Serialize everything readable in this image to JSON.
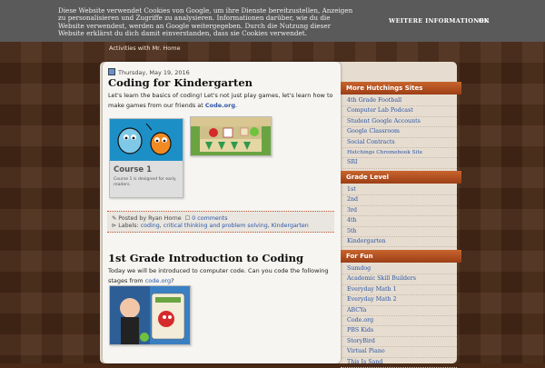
{
  "cookie": {
    "text": "Diese Website verwendet Cookies von Google, um ihre Dienste bereitzustellen, Anzeigen zu personalisieren und Zugriffe zu analysieren. Informationen darüber, wie du die Website verwendest, werden an Google weitergegeben. Durch die Nutzung dieser Website erklärst du dich damit einverstanden, dass sie Cookies verwendet.",
    "more": "WEITERE INFORMATIONEN",
    "ok": "OK"
  },
  "nav": {
    "link": "Activities with Mr. Home"
  },
  "post1": {
    "date": "Thursday, May 19, 2016",
    "title": "Coding for Kindergarten",
    "body_pre": "Let's learn the basics of coding! Let's not just play games, let's learn how to make games from our friends at ",
    "body_link": "Code.org",
    "body_post": ".",
    "card_title": "Course 1",
    "card_desc": "Course 1 is designed for early readers.",
    "posted_by": "Posted by Ryan Horne",
    "comments": "0 comments",
    "labels_label": "Labels:",
    "labels": [
      "coding",
      "critical thinking and problem solving",
      "Kindergarten"
    ]
  },
  "post2": {
    "title": "1st Grade Introduction to Coding",
    "body_pre": "Today we will be introduced to computer code. Can you code the following stages from ",
    "body_link": "code.org",
    "body_post": "?"
  },
  "sidebar": {
    "hutchings": {
      "title": "More Hutchings Sites",
      "items": [
        "4th Grade Football",
        "Computer Lab Podcast",
        "Student Google Accounts",
        "Google Classroom",
        "Social Contracts",
        "Hutchings Chromebook Site",
        "SRI"
      ]
    },
    "grade": {
      "title": "Grade Level",
      "items": [
        "1st",
        "2nd",
        "3rd",
        "4th",
        "5th",
        "Kindergarten"
      ]
    },
    "fun": {
      "title": "For Fun",
      "items": [
        "Sumdog",
        "Academic Skill Builders",
        "Everyday Math 1",
        "Everyday Math 2",
        "ABCYa",
        "Code.org",
        "PBS Kids",
        "StoryBird",
        "Virtual Piano",
        "This Is Sand"
      ]
    }
  },
  "colors": {
    "accent": "#b4522a",
    "link": "#2b55a5",
    "background": "#4a2a17"
  }
}
